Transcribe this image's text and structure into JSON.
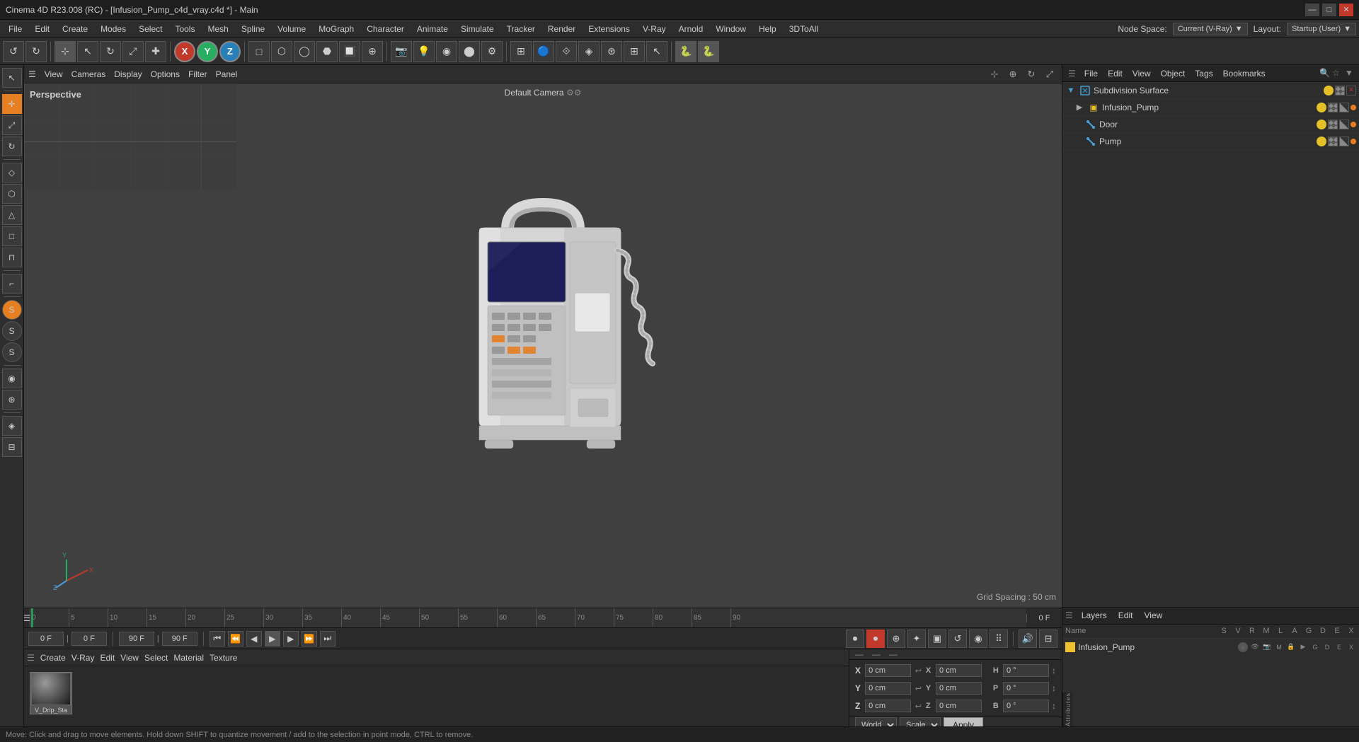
{
  "window": {
    "title": "Cinema 4D R23.008 (RC) - [Infusion_Pump_c4d_vray.c4d *] - Main"
  },
  "titlebar": {
    "minimize": "—",
    "maximize": "□",
    "close": "✕"
  },
  "menu": {
    "items": [
      "File",
      "Edit",
      "Create",
      "Modes",
      "Select",
      "Tools",
      "Mesh",
      "Spline",
      "Volume",
      "MoGraph",
      "Character",
      "Animate",
      "Simulate",
      "Tracker",
      "Render",
      "Extensions",
      "V-Ray",
      "Arnold",
      "Window",
      "Help",
      "3DToAll"
    ],
    "node_space_label": "Node Space:",
    "node_space_value": "Current (V-Ray)",
    "layout_label": "Layout:",
    "layout_value": "Startup (User)"
  },
  "viewport_toolbar": {
    "items": [
      "View",
      "Cameras",
      "Display",
      "Options",
      "Filter",
      "Panel"
    ]
  },
  "viewport": {
    "label_perspective": "Perspective",
    "label_camera": "Default Camera",
    "grid_spacing": "Grid Spacing : 50 cm"
  },
  "timeline": {
    "markers": [
      "0",
      "5",
      "10",
      "15",
      "20",
      "25",
      "30",
      "35",
      "40",
      "45",
      "50",
      "55",
      "60",
      "65",
      "70",
      "75",
      "80",
      "85",
      "90"
    ],
    "current_frame": "0 F"
  },
  "transport": {
    "start_frame": "0 F",
    "start_frame2": "0 F",
    "end_frame": "90 F",
    "end_frame2": "90 F"
  },
  "material_manager": {
    "toolbar": [
      "Create",
      "V-Ray",
      "Edit",
      "View",
      "Select",
      "Material",
      "Texture"
    ],
    "materials": [
      {
        "label": "V_Drip_Sta"
      }
    ]
  },
  "coords": {
    "x_pos": "0 cm",
    "y_pos": "0 cm",
    "z_pos": "0 cm",
    "x_rot": "0 cm",
    "y_rot": "0 cm",
    "z_rot": "0 cm",
    "h": "0 °",
    "p": "0 °",
    "b": "0 °",
    "world": "World",
    "mode": "Scale",
    "apply": "Apply"
  },
  "object_manager": {
    "toolbar": [
      "File",
      "Edit",
      "View",
      "Object",
      "Tags",
      "Bookmarks"
    ],
    "tree": [
      {
        "label": "Subdivision Surface",
        "type": "subdiv",
        "level": 0
      },
      {
        "label": "Infusion_Pump",
        "type": "folder",
        "level": 1
      },
      {
        "label": "Door",
        "type": "bone",
        "level": 2
      },
      {
        "label": "Pump",
        "type": "bone",
        "level": 2
      }
    ]
  },
  "layer_manager": {
    "toolbar": [
      "Layers",
      "Edit",
      "View"
    ],
    "header_cols": [
      "S",
      "V",
      "R",
      "M",
      "L",
      "A",
      "G",
      "D",
      "E",
      "X"
    ],
    "rows": [
      {
        "label": "Infusion_Pump",
        "color": "yellow"
      }
    ]
  },
  "status_bar": {
    "text": "Move: Click and drag to move elements. Hold down SHIFT to quantize movement / add to the selection in point mode, CTRL to remove."
  }
}
